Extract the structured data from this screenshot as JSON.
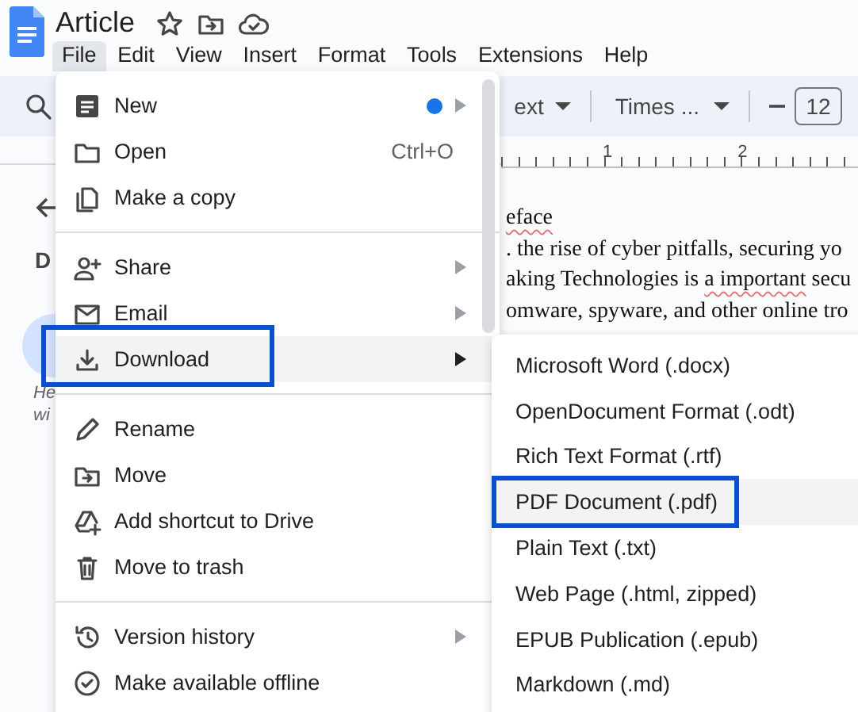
{
  "document": {
    "title": "Article"
  },
  "menu_bar": [
    {
      "label": "File",
      "selected": true
    },
    {
      "label": "Edit",
      "selected": false
    },
    {
      "label": "View",
      "selected": false
    },
    {
      "label": "Insert",
      "selected": false
    },
    {
      "label": "Format",
      "selected": false
    },
    {
      "label": "Tools",
      "selected": false
    },
    {
      "label": "Extensions",
      "selected": false
    },
    {
      "label": "Help",
      "selected": false
    }
  ],
  "toolbar": {
    "style": "ext",
    "font": "Times ...",
    "font_size": "12"
  },
  "ruler": [
    "1",
    "2"
  ],
  "side_panel": {
    "heading": "D",
    "hint_lines": [
      "He",
      "wi"
    ]
  },
  "document_text": [
    {
      "segments": [
        {
          "text": "eface",
          "misspelled": true
        }
      ]
    },
    {
      "segments": [
        {
          "text": ". the rise of cyber pitfalls, securing yo",
          "misspelled": false
        }
      ]
    },
    {
      "segments": [
        {
          "text": "aking Technologies is ",
          "misspelled": false
        },
        {
          "text": "a important",
          "misspelled": true
        },
        {
          "text": " secu",
          "misspelled": false
        }
      ]
    },
    {
      "segments": [
        {
          "text": "omware, spyware, and other online tro",
          "misspelled": false
        }
      ]
    }
  ],
  "file_menu": [
    {
      "kind": "item",
      "label": "New",
      "submenu": true,
      "dot": true,
      "selected": false,
      "outlined": false
    },
    {
      "kind": "item",
      "label": "Open",
      "shortcut": "Ctrl+O",
      "submenu": false,
      "dot": false,
      "selected": false,
      "outlined": false
    },
    {
      "kind": "item",
      "label": "Make a copy",
      "submenu": false,
      "dot": false,
      "selected": false,
      "outlined": false
    },
    {
      "kind": "divider"
    },
    {
      "kind": "item",
      "label": "Share",
      "submenu": true,
      "dot": false,
      "selected": false,
      "outlined": false
    },
    {
      "kind": "item",
      "label": "Email",
      "submenu": true,
      "dot": false,
      "selected": false,
      "outlined": false
    },
    {
      "kind": "item",
      "label": "Download",
      "submenu": true,
      "dot": false,
      "selected": true,
      "outlined": true
    },
    {
      "kind": "divider"
    },
    {
      "kind": "item",
      "label": "Rename",
      "submenu": false,
      "dot": false,
      "selected": false,
      "outlined": false
    },
    {
      "kind": "item",
      "label": "Move",
      "submenu": false,
      "dot": false,
      "selected": false,
      "outlined": false
    },
    {
      "kind": "item",
      "label": "Add shortcut to Drive",
      "submenu": false,
      "dot": false,
      "selected": false,
      "outlined": false
    },
    {
      "kind": "item",
      "label": "Move to trash",
      "submenu": false,
      "dot": false,
      "selected": false,
      "outlined": false
    },
    {
      "kind": "divider"
    },
    {
      "kind": "item",
      "label": "Version history",
      "submenu": true,
      "dot": false,
      "selected": false,
      "outlined": false
    },
    {
      "kind": "item",
      "label": "Make available offline",
      "submenu": false,
      "dot": false,
      "selected": false,
      "outlined": false
    }
  ],
  "download_submenu": [
    {
      "label": "Microsoft Word (.docx)",
      "selected": false,
      "outlined": false
    },
    {
      "label": "OpenDocument Format (.odt)",
      "selected": false,
      "outlined": false
    },
    {
      "label": "Rich Text Format (.rtf)",
      "selected": false,
      "outlined": false
    },
    {
      "label": "PDF Document (.pdf)",
      "selected": true,
      "outlined": true
    },
    {
      "label": "Plain Text (.txt)",
      "selected": false,
      "outlined": false
    },
    {
      "label": "Web Page (.html, zipped)",
      "selected": false,
      "outlined": false
    },
    {
      "label": "EPUB Publication (.epub)",
      "selected": false,
      "outlined": false
    },
    {
      "label": "Markdown (.md)",
      "selected": false,
      "outlined": false
    }
  ]
}
